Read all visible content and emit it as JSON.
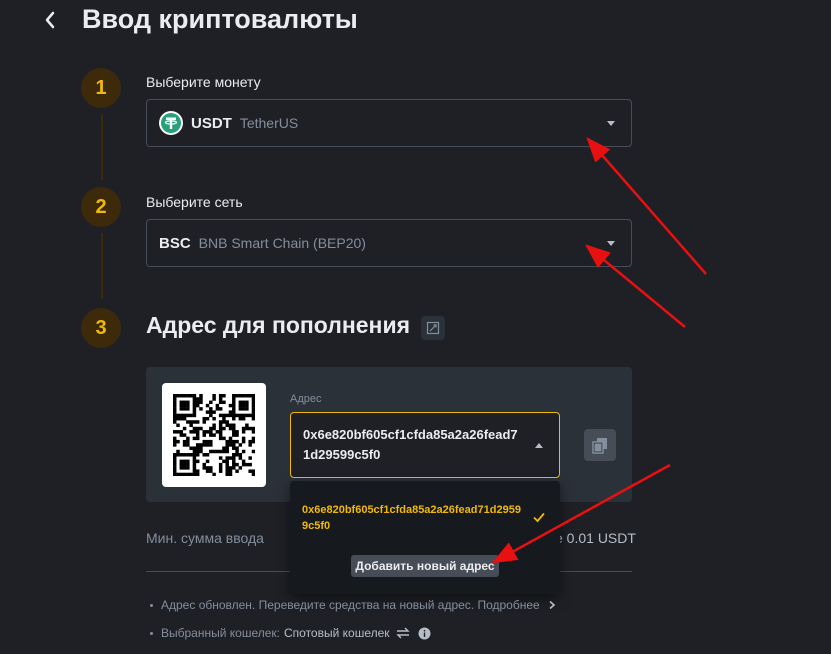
{
  "header": {
    "title": "Ввод криптовалюты"
  },
  "steps": {
    "step1": "1",
    "step2": "2",
    "step3": "3"
  },
  "coin_select": {
    "label": "Выберите монету",
    "code": "USDT",
    "name": "TetherUS",
    "icon": "tether-icon"
  },
  "network_select": {
    "label": "Выберите сеть",
    "code": "BSC",
    "name": "BNB Smart Chain (BEP20)"
  },
  "deposit_address": {
    "title": "Адрес для пополнения",
    "field_label": "Адрес",
    "value": "0x6e820bf605cf1cfda85a2a26fead71d29599c5f0"
  },
  "address_dropdown": {
    "options": [
      "0x6e820bf605cf1cfda85a2a26fead71d29599c5f0"
    ],
    "add_label": "Добавить новый адрес"
  },
  "min_deposit": {
    "label": "Мин. сумма ввода",
    "value": "e 0.01 USDT"
  },
  "notes": {
    "address_updated": "Адрес обновлен. Переведите средства на новый адрес. Подробнее",
    "wallet_label": "Выбранный кошелек:",
    "wallet_value": "Спотовый кошелек"
  },
  "colors": {
    "background": "#1e2026",
    "accent": "#f0b90b",
    "panel": "#2b3139",
    "annotation_arrow": "#e81010"
  }
}
